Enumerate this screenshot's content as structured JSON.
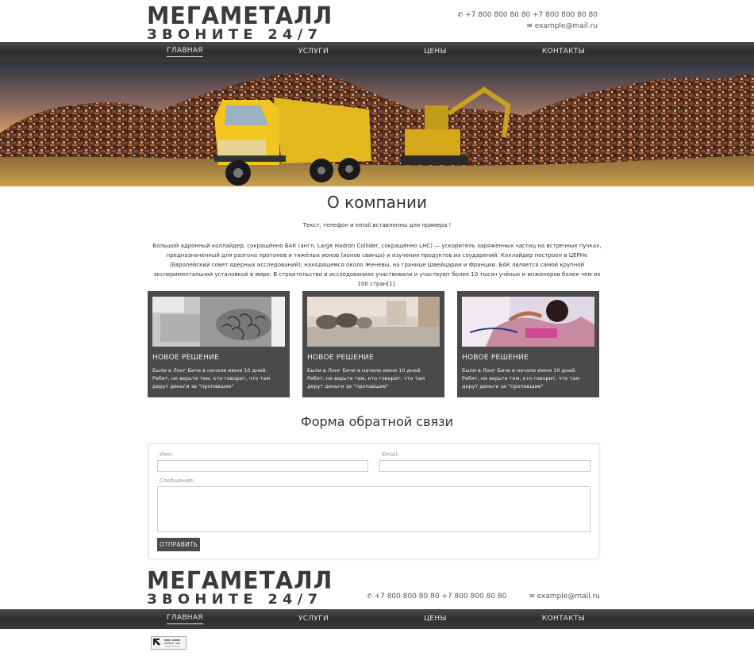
{
  "header": {
    "logo_top": "МЕГАМЕТАЛЛ",
    "logo_bottom": "ЗВОНИТЕ 24/7",
    "phones": "+7 800 800 80 80  +7 800 800 80 80",
    "email": "example@mail.ru"
  },
  "nav": {
    "items": [
      "ГЛАВНАЯ",
      "УСЛУГИ",
      "ЦЕНЫ",
      "КОНТАКТЫ"
    ],
    "active_index": 0
  },
  "about": {
    "title": "О компании",
    "subtitle": "Текст, телефон и email вставленны для примера !",
    "text": "Большой адронный коллайдер, сокращённо БАК (англ. Large Hadron Collider, сокращённо LHC) — ускоритель заряженных частиц на встречных пучках, предназначенный для разгона протонов и тяжёлых ионов (ионов свинца) и изучения продуктов их соударений. Коллайдер построен в ЦЕРНе (Европейский совет ядерных исследований), находящемся около Женевы, на границе Швейцарии и Франции. БАК является самой крупной экспериментальной установкой в мире. В строительстве и исследованиях участвовали и участвуют более 10 тысяч учёных и инженеров более чем из 100 стран[1]."
  },
  "cards": [
    {
      "title": "НОВОЕ РЕШЕНИЕ",
      "text": "Были в Лонг Биче в начале июня 10 дней. Ребят, не верьте тем, кто говорит, что там дерут деньги за \"пропавшие\"",
      "image": "paperclips-photo"
    },
    {
      "title": "НОВОЕ РЕШЕНИЕ",
      "text": "Были в Лонг Биче в начале июня 10 дней. Ребят, не верьте тем, кто говорит, что там дерут деньги за \"пропавшие\"",
      "image": "bedroom-photo"
    },
    {
      "title": "НОВОЕ РЕШЕНИЕ",
      "text": "Были в Лонг Биче в начале июня 10 дней. Ребят, не верьте тем, кто говорит, что там дерут деньги за \"пропавшие\"",
      "image": "woman-photo"
    }
  ],
  "form": {
    "title": "Форма обратной связи",
    "name_label": "Имя:",
    "email_label": "Email:",
    "message_label": "Сообщение:",
    "name_value": "",
    "email_value": "",
    "message_value": "",
    "submit_label": "ОТПРАВИТЬ"
  },
  "footer": {
    "logo_top": "МЕГАМЕТАЛЛ",
    "logo_bottom": "ЗВОНИТЕ 24/7",
    "phones": "+7 800 800 80 80  +7 800 800 80 80",
    "email": "example@mail.ru",
    "nav_items": [
      "ГЛАВНАЯ",
      "УСЛУГИ",
      "ЦЕНЫ",
      "КОНТАКТЫ"
    ]
  },
  "colors": {
    "nav_bg": "#3a3a3a",
    "card_bg": "#4a4a4a",
    "button_bg": "#4a4a4a",
    "text": "#333333"
  }
}
